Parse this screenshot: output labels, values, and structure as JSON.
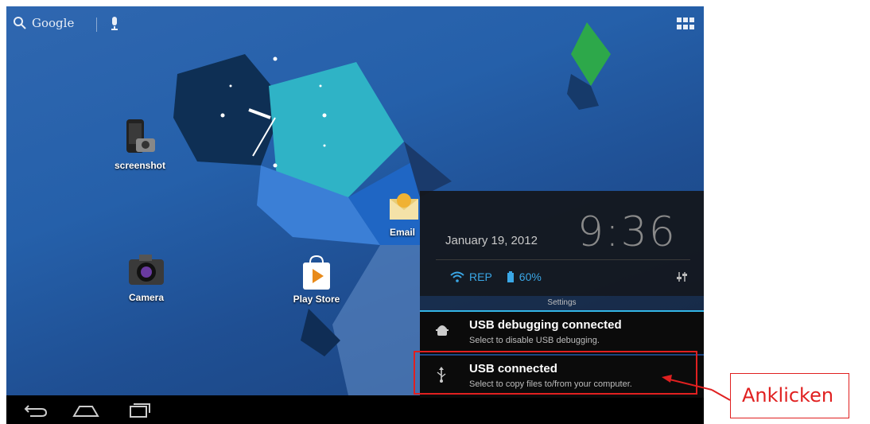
{
  "topbar": {
    "search_label": "Google"
  },
  "desktop": {
    "icons": [
      {
        "label": "screenshot"
      },
      {
        "label": "Camera"
      },
      {
        "label": "Play Store"
      },
      {
        "label": "Email"
      }
    ]
  },
  "notification_panel": {
    "date": "January 19, 2012",
    "time": "9:36",
    "wifi_name": "REP",
    "battery": "60%",
    "settings_label": "Settings",
    "items": [
      {
        "title": "USB debugging connected",
        "subtitle": "Select to disable USB debugging."
      },
      {
        "title": "USB connected",
        "subtitle": "Select to copy files to/from your computer."
      }
    ]
  },
  "annotation": {
    "callout_text": "Anklicken",
    "color": "#e02020"
  },
  "colors": {
    "accent": "#33b5e5",
    "wallpaper": "#2560aa"
  }
}
